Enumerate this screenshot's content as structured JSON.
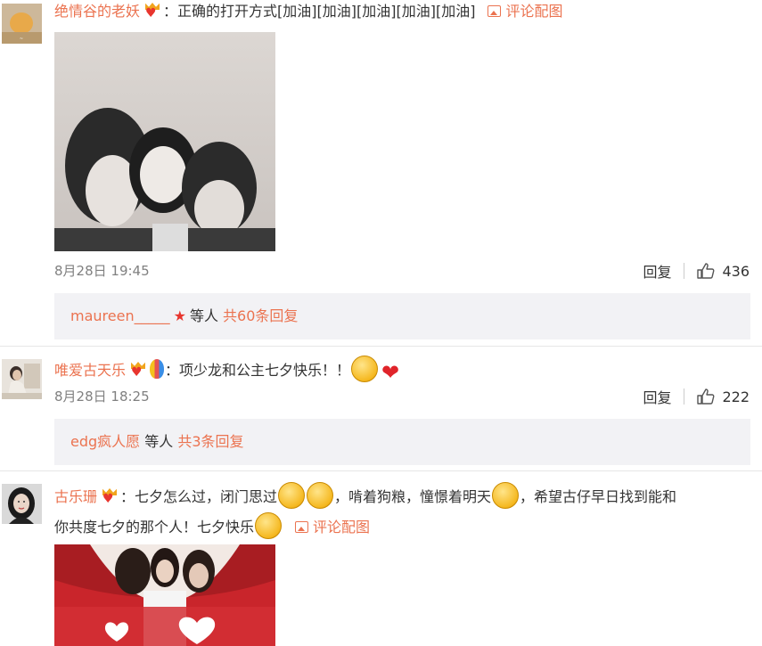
{
  "comments": [
    {
      "username": "绝情谷的老妖",
      "text": "：正确的打开方式[加油][加油][加油][加油][加油]",
      "pic_link": "评论配图",
      "time": "8月28日 19:45",
      "reply_label": "回复",
      "likes": "436",
      "reply_user": "maureen_____",
      "reply_suffix": "等人",
      "reply_count": "共60条回复"
    },
    {
      "username": "唯爱古天乐",
      "text": "：项少龙和公主七夕快乐！！",
      "time": "8月28日 18:25",
      "reply_label": "回复",
      "likes": "222",
      "reply_user": "edg疯人愿",
      "reply_suffix": "等人",
      "reply_count": "共3条回复"
    },
    {
      "username": "古乐珊",
      "text_a": "：七夕怎么过，闭门思过",
      "text_b": "，啃着狗粮，憧憬着明天",
      "text_c": "，希望古仔早日找到能和",
      "text_d": "你共度七夕的那个人！七夕快乐",
      "pic_link": "评论配图"
    }
  ],
  "colors": {
    "accent": "#eb7350",
    "reply_bg": "#f2f2f5",
    "meta": "#808080"
  }
}
